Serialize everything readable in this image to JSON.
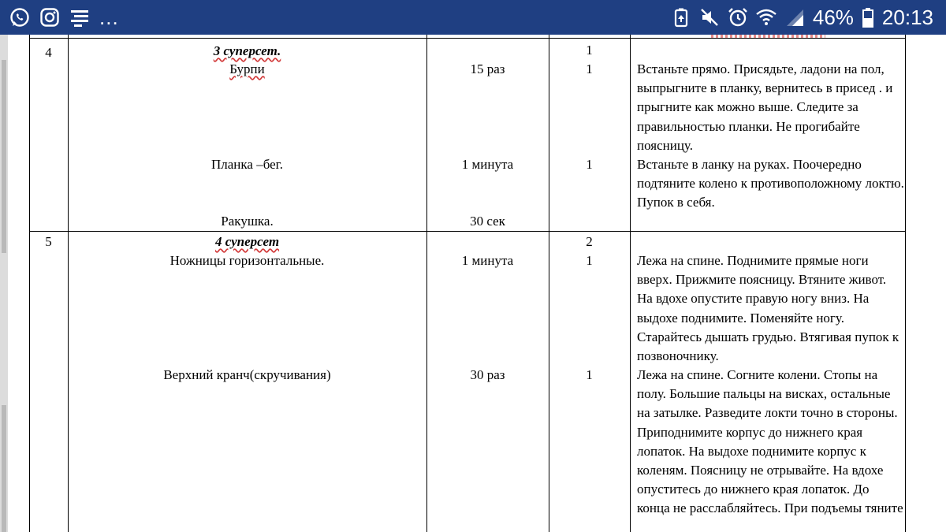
{
  "status_bar": {
    "battery_percent": "46%",
    "time": "20:13",
    "more": "...",
    "left_icons": [
      "whatsapp-icon",
      "instagram-icon",
      "menu-lines-icon"
    ],
    "right_icons": [
      "battery-saver-icon",
      "mute-icon",
      "alarm-icon",
      "wifi-icon",
      "signal-icon",
      "battery-icon"
    ]
  },
  "table": {
    "rows": [
      {
        "number": "4",
        "superset": "3 суперсет.",
        "exercises": [
          {
            "name": "Бурпи",
            "reps": "15 раз",
            "sets": "1"
          },
          {
            "name": "Планка –бег.",
            "reps": "1 минута",
            "sets": "1"
          },
          {
            "name": "Ракушка.",
            "reps": "30 сек",
            "sets": ""
          }
        ],
        "superset_sets": "1",
        "descriptions": [
          "Встаньте прямо. Присядьте, ладони на пол, выпрыгните в планку, вернитесь в присед . и прыгните как можно выше. Следите за правильностью планки. Не прогибайте поясницу.",
          "Встаньте в ланку на руках. Поочередно подтяните колено к противоположному локтю. Пупок в себя."
        ]
      },
      {
        "number": "5",
        "superset": "4 суперсет",
        "exercises": [
          {
            "name": "Ножницы горизонтальные.",
            "reps": "1 минута",
            "sets": "1"
          },
          {
            "name": "Верхний кранч(скручивания)",
            "reps": "30 раз",
            "sets": "1"
          }
        ],
        "superset_sets": "2",
        "descriptions": [
          "Лежа на спине. Поднимите прямые ноги вверх. Прижмите поясницу. Втяните живот. На вдохе опустите правую ногу вниз. На выдохе поднимите. Поменяйте ногу. Старайтесь дышать грудью. Втягивая пупок к позвоночнику.",
          "Лежа на спине. Согните колени. Стопы на полу. Большие пальцы на висках, остальные на затылке. Разведите локти точно в стороны. Приподнимите корпус до нижнего края лопаток. На выдохе поднимите корпус к коленям. Поясницу не отрывайте. На вдохе опуститесь до нижнего края лопаток. До конца не расслабляйтесь. При подъемы тяните"
        ]
      }
    ]
  }
}
